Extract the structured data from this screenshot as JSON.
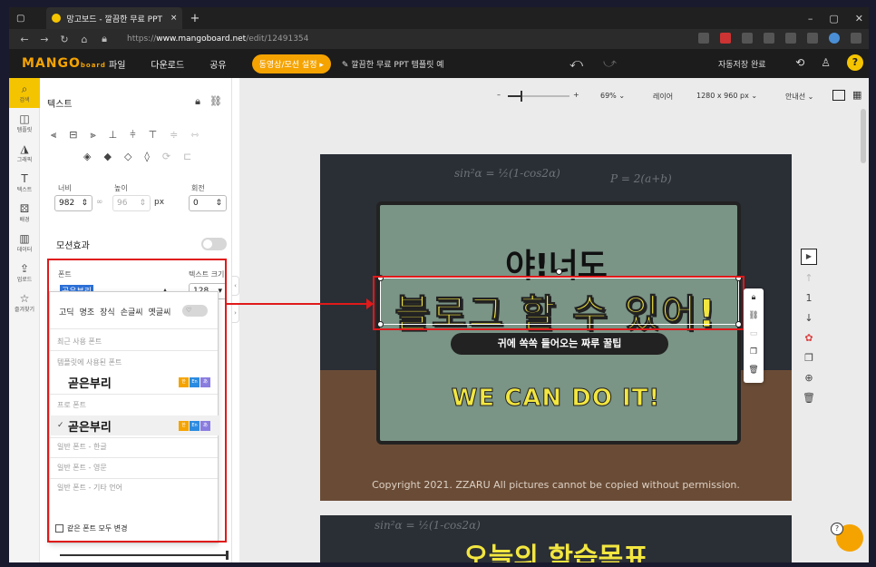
{
  "browser": {
    "tab_title": "망고보드 - 깔끔한 무료 PPT 템플",
    "url_prefix": "https://",
    "url_host": "www.mangoboard.net",
    "url_path": "/edit/12491354",
    "new_tab": "+",
    "close_tab": "×"
  },
  "app": {
    "logo": "MANGO",
    "logo_sub": "board",
    "menu": [
      "파일",
      "다운로드",
      "공유"
    ],
    "motion_button": "동영상/모션 설정 ▸",
    "doc_title": "깔끔한 무료 PPT 템플릿 예",
    "autosave": "자동저장 완료"
  },
  "rail": [
    {
      "label": "검색",
      "icon": "search-icon"
    },
    {
      "label": "템플릿",
      "icon": "template-icon"
    },
    {
      "label": "그래픽",
      "icon": "graphic-icon"
    },
    {
      "label": "텍스트",
      "icon": "text-icon"
    },
    {
      "label": "배경",
      "icon": "background-icon"
    },
    {
      "label": "데이터",
      "icon": "chart-icon"
    },
    {
      "label": "업로드",
      "icon": "upload-icon"
    },
    {
      "label": "즐겨찾기",
      "icon": "star-icon"
    }
  ],
  "panel": {
    "title": "텍스트",
    "width_label": "너비",
    "height_label": "높이",
    "rotate_label": "회전",
    "width_value": "982",
    "height_value": "96",
    "unit": "px",
    "rotate_value": "0",
    "motion_label": "모션효과",
    "font_label": "폰트",
    "font_size_label": "텍스트 크기",
    "font_value": "곧은부리",
    "font_size_value": "128"
  },
  "font_dropdown": {
    "filters": [
      "고딕",
      "명조",
      "장식",
      "손글씨",
      "옛글씨"
    ],
    "recent": "최근 사용 폰트",
    "template_used": "템플릿에 사용된 폰트",
    "template_font": "곧은부리",
    "pro": "프로 폰트",
    "pro_font": "곧은부리",
    "general_ko": "일반 폰트 - 한글",
    "general_en": "일반 폰트 - 영문",
    "general_other": "일반 폰트 - 기타 언어",
    "change_all": "같은 폰트 모두 변경",
    "lang_tags": [
      "한",
      "En",
      "あ"
    ]
  },
  "canvas": {
    "zoom": "69%",
    "layer": "레이어",
    "size": "1280 x 960 px",
    "guide": "안내선",
    "headline1": "야!너도",
    "headline2": "블로그 할 수 있어!",
    "pill": "귀에 쏙쏙 들어오는 짜루 꿀팁",
    "wecan": "WE CAN DO IT!",
    "copyright": "Copyright 2021. ZZARU All pictures cannot be copied without permission.",
    "slide2_title": "오늘의 학습목표",
    "chalk1": "sin²α = ½(1-cos2α)",
    "chalk2": "P = 2(a+b)",
    "page_num": "1"
  }
}
